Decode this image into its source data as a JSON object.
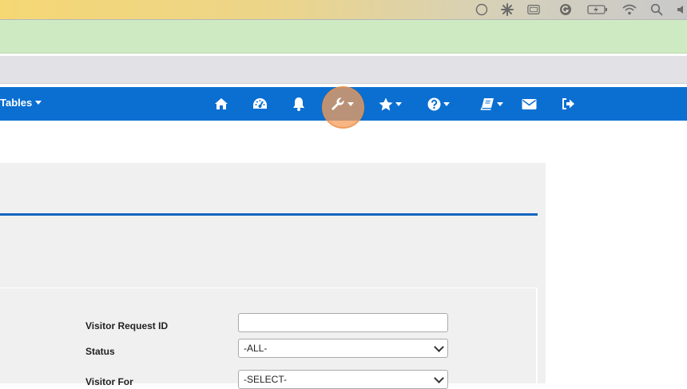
{
  "menubar": {
    "icons": [
      "circle-icon",
      "asterisk-icon",
      "window-icon",
      "grammarly-icon",
      "battery-icon",
      "wifi-icon",
      "search-icon",
      "volume-icon"
    ]
  },
  "nav": {
    "tables_label": "Tables",
    "icons": [
      "home-icon",
      "dashboard-icon",
      "bell-icon",
      "wrench-icon",
      "star-icon",
      "question-icon",
      "book-icon",
      "envelope-icon",
      "sign-out-icon"
    ]
  },
  "form": {
    "visitor_request_id_label": "Visitor Request  ID",
    "visitor_request_id_value": "",
    "status_label": "Status",
    "status_value": "-ALL-",
    "visitor_for_label": "Visitor For",
    "visitor_for_value": "-SELECT-"
  },
  "colors": {
    "nav_bg": "#0a6fd1",
    "accent_rule": "#1565c0",
    "highlight": "#f59e5a"
  }
}
